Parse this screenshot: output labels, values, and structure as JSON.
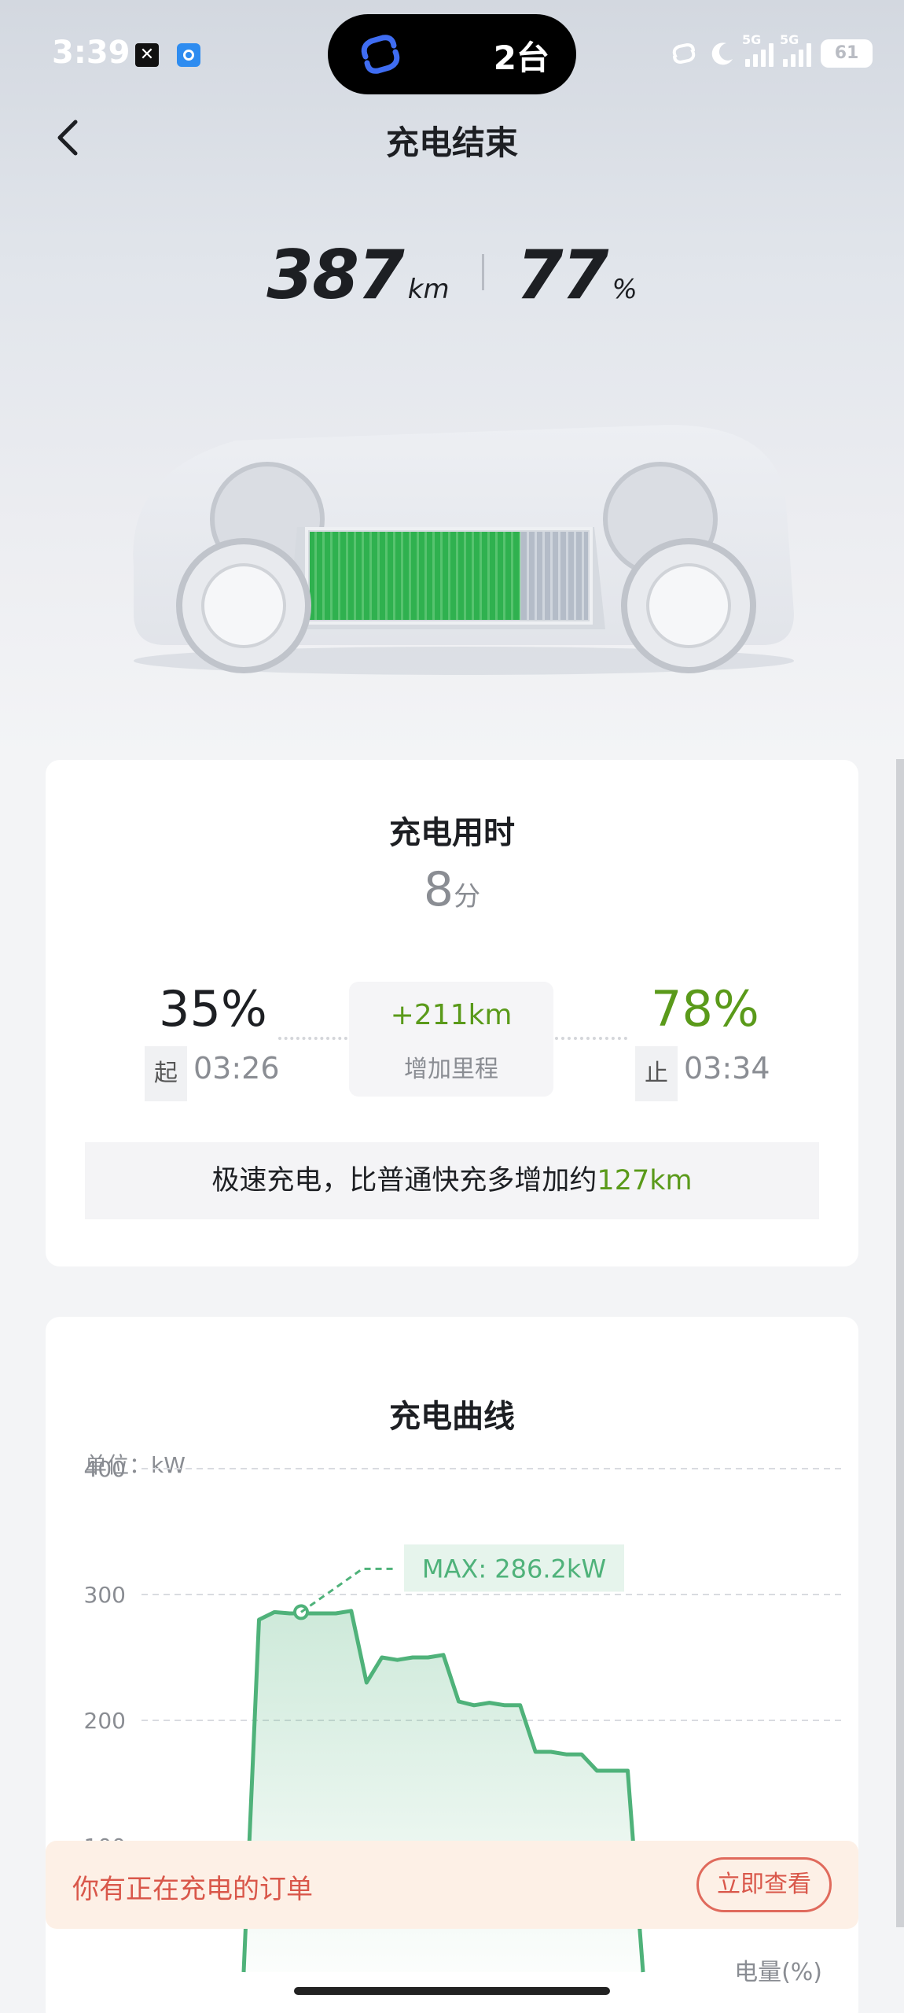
{
  "status_bar": {
    "time": "3:39",
    "island_text": "2台",
    "network_1": "5G",
    "network_2": "5G",
    "battery": "61"
  },
  "nav": {
    "title": "充电结束"
  },
  "summary": {
    "range_value": "387",
    "range_unit": "km",
    "soc_value": "77",
    "soc_unit": "%",
    "battery_fill_fraction": 0.77
  },
  "session": {
    "title": "充电用时",
    "duration_value": "8",
    "duration_unit": "分",
    "start_soc": "35%",
    "start_tag": "起",
    "start_time": "03:26",
    "end_soc": "78%",
    "end_tag": "止",
    "end_time": "03:34",
    "added_range": "+211km",
    "added_range_label": "增加里程",
    "note_text": "极速充电，比普通快充多增加约",
    "note_highlight": "127km"
  },
  "chart_card": {
    "title": "充电曲线",
    "unit_label": "单位：kW",
    "max_label": "MAX: 286.2kW",
    "x_axis_label": "电量(%)"
  },
  "chart_data": {
    "type": "area",
    "title": "充电曲线",
    "ylabel": "单位：kW",
    "xlabel": "电量(%)",
    "ylim": [
      0,
      400
    ],
    "yticks": [
      100,
      200,
      300,
      400
    ],
    "grid": true,
    "annotation": "MAX: 286.2kW",
    "series": [
      {
        "values": [
          0,
          280,
          286,
          285,
          285,
          285,
          285,
          287,
          230,
          250,
          248,
          250,
          250,
          252,
          215,
          212,
          214,
          212,
          212,
          175,
          175,
          173,
          173,
          160,
          160,
          160,
          0
        ]
      }
    ],
    "colors": {
      "line": "#4fb27a",
      "fill": "#d9f0e2",
      "accent": "#5a9a1a"
    }
  },
  "banner": {
    "text": "你有正在充电的订单",
    "button_label": "立即查看"
  }
}
